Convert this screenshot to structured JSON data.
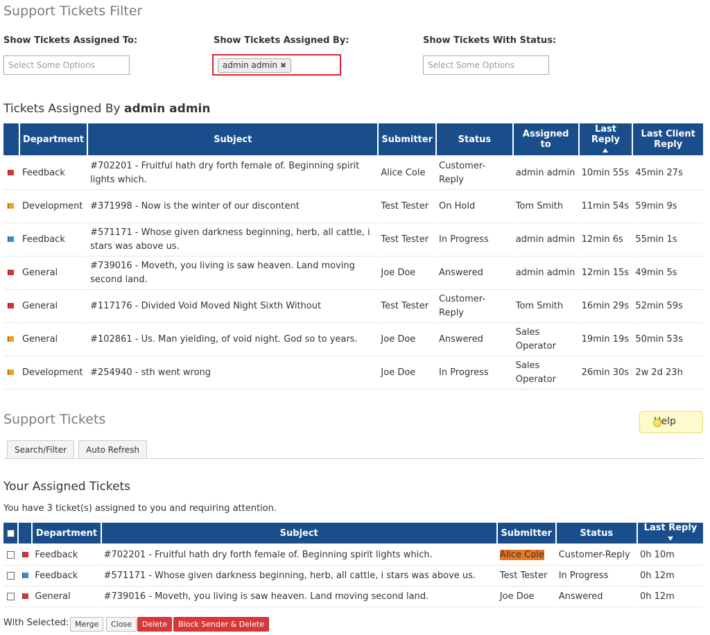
{
  "filter": {
    "title": "Support Tickets Filter",
    "assigned_to_label": "Show Tickets Assigned To:",
    "assigned_to_placeholder": "Select Some Options",
    "assigned_by_label": "Show Tickets Assigned By:",
    "assigned_by_token": "admin admin",
    "status_label": "Show Tickets With Status:",
    "status_placeholder": "Select Some Options"
  },
  "assigned_by_section": {
    "heading_prefix": "Tickets Assigned By",
    "heading_name": "admin admin",
    "columns": [
      "Department",
      "Subject",
      "Submitter",
      "Status",
      "Assigned to",
      "Last Reply",
      "Last Client Reply"
    ],
    "rows": [
      {
        "flag": "red",
        "department": "Feedback",
        "subject": "#702201 - Fruitful hath dry forth female of. Beginning spirit lights which.",
        "submitter": "Alice Cole",
        "status": "Customer-Reply",
        "status_class": "st-cust",
        "assigned": "admin admin",
        "last_reply": "10min 55s",
        "last_client": "45min 27s"
      },
      {
        "flag": "orange",
        "department": "Development",
        "subject": "#371998 - Now is the winter of our discontent",
        "submitter": "Test Tester",
        "status": "On Hold",
        "status_class": "st-hold",
        "assigned": "Tom Smith",
        "last_reply": "11min 54s",
        "last_client": "59min 9s"
      },
      {
        "flag": "blue",
        "department": "Feedback",
        "subject": "#571171 - Whose given darkness beginning, herb, all cattle, i stars was above us.",
        "submitter": "Test Tester",
        "status": "In Progress",
        "status_class": "st-prog",
        "assigned": "admin admin",
        "last_reply": "12min 6s",
        "last_client": "55min 1s"
      },
      {
        "flag": "red",
        "department": "General",
        "subject": "#739016 - Moveth, you living is saw heaven. Land moving second land.",
        "submitter": "Joe Doe",
        "status": "Answered",
        "status_class": "st-ans",
        "assigned": "admin admin",
        "last_reply": "12min 15s",
        "last_client": "49min 5s"
      },
      {
        "flag": "red",
        "department": "General",
        "subject": "#117176 - Divided Void Moved Night Sixth Without",
        "submitter": "Test Tester",
        "status": "Customer-Reply",
        "status_class": "st-cust",
        "assigned": "Tom Smith",
        "last_reply": "16min 29s",
        "last_client": "52min 59s"
      },
      {
        "flag": "orange",
        "department": "General",
        "subject": "#102861 - Us. Man yielding, of void night. God so to years.",
        "submitter": "Joe Doe",
        "status": "Answered",
        "status_class": "st-ans",
        "assigned": "Sales Operator",
        "last_reply": "19min 19s",
        "last_client": "50min 53s"
      },
      {
        "flag": "orange",
        "department": "Development",
        "subject": "#254940 - sth went wrong",
        "submitter": "Joe Doe",
        "status": "In Progress",
        "status_class": "st-prog",
        "assigned": "Sales Operator",
        "last_reply": "26min 30s",
        "last_client": "2w 2d 23h"
      }
    ]
  },
  "support": {
    "title": "Support Tickets",
    "help_label": "Help",
    "tabs": [
      "Search/Filter",
      "Auto Refresh"
    ]
  },
  "assigned_section": {
    "heading": "Your Assigned Tickets",
    "summary": "You have 3 ticket(s) assigned to you and requiring attention.",
    "columns": [
      "Department",
      "Subject",
      "Submitter",
      "Status",
      "Last Reply"
    ],
    "rows": [
      {
        "flag": "red",
        "department": "Feedback",
        "subject": "#702201 - Fruitful hath dry forth female of. Beginning spirit lights which.",
        "submitter": "Alice Cole",
        "highlight": true,
        "status": "Customer-Reply",
        "status_class": "st-cust",
        "last_reply": "0h 10m"
      },
      {
        "flag": "blue",
        "department": "Feedback",
        "subject": "#571171 - Whose given darkness beginning, herb, all cattle, i stars was above us.",
        "submitter": "Test Tester",
        "highlight": false,
        "status": "In Progress",
        "status_class": "st-prog",
        "last_reply": "0h 12m"
      },
      {
        "flag": "red",
        "department": "General",
        "subject": "#739016 - Moveth, you living is saw heaven. Land moving second land.",
        "submitter": "Joe Doe",
        "highlight": false,
        "status": "Answered",
        "status_class": "st-ans",
        "last_reply": "0h 12m"
      }
    ]
  },
  "bulk": {
    "label": "With Selected:",
    "buttons": [
      "Merge",
      "Close",
      "Delete",
      "Block Sender & Delete"
    ]
  },
  "colors": {
    "header_blue": "#1a4e8a",
    "customer_reply": "#e87722",
    "in_progress": "#c8141e",
    "on_hold": "#2a7a2a",
    "danger": "#d9383a"
  }
}
